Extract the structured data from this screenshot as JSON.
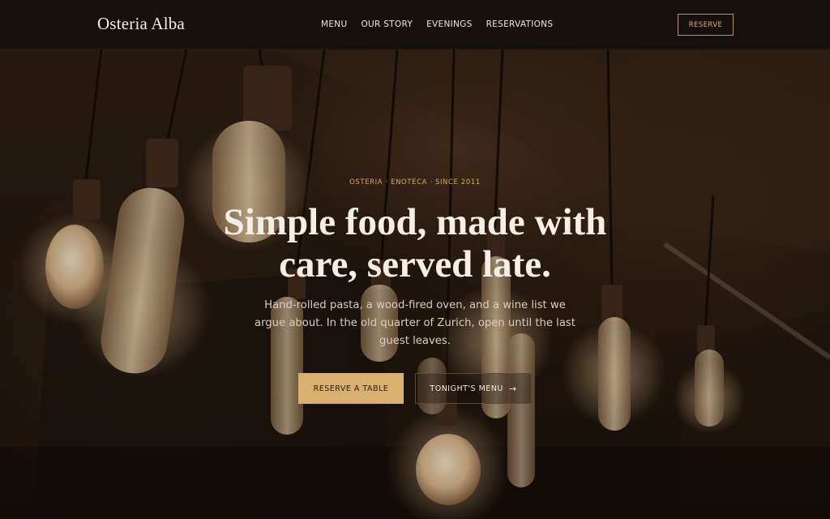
{
  "header": {
    "logo": "Osteria Alba",
    "nav": [
      {
        "label": "MENU"
      },
      {
        "label": "OUR STORY"
      },
      {
        "label": "EVENINGS"
      },
      {
        "label": "RESERVATIONS"
      }
    ],
    "reserve_label": "RESERVE"
  },
  "hero": {
    "eyebrow": "OSTERIA · ENOTECA · SINCE 2011",
    "headline_line1": "Simple food, made with",
    "headline_line2": "care, served late.",
    "subtext": "Hand-rolled pasta, a wood-fired oven, and a wine list we argue about. In the old quarter of Zurich, open until the last guest leaves.",
    "primary_cta": "RESERVE A TABLE",
    "secondary_cta": "TONIGHT'S MENU",
    "secondary_icon": "arrow-right-icon",
    "background_image": "hanging-edison-bulbs-photo"
  },
  "colors": {
    "header_bg": "#15100c",
    "accent": "#d9b06e",
    "text": "#f6efe6"
  }
}
